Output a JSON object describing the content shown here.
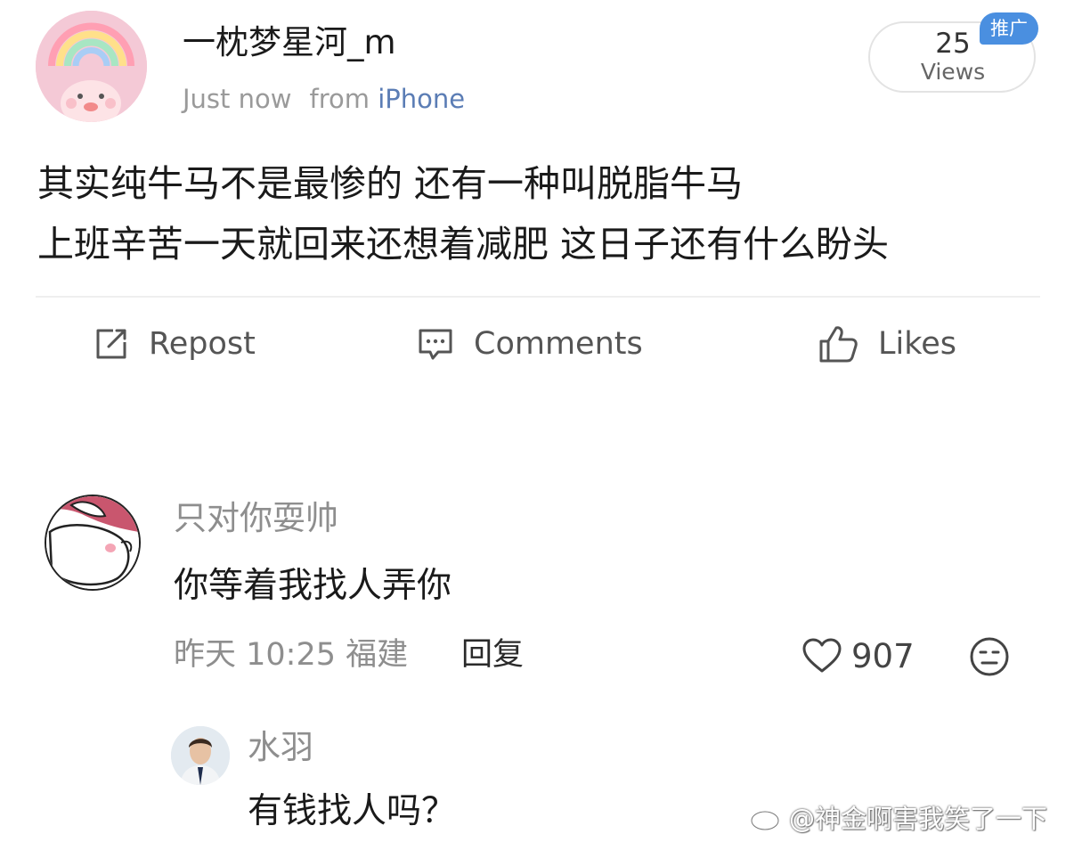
{
  "post": {
    "author": {
      "name": "一枕梦星河_m"
    },
    "timestamp": "Just now",
    "source_prefix": "from",
    "source_device": "iPhone",
    "views": {
      "count": "25",
      "label": "Views"
    },
    "promo_badge": "推广",
    "text_lines": [
      "其实纯牛马不是最惨的 还有一种叫脱脂牛马",
      "上班辛苦一天就回来还想着减肥 这日子还有什么盼头"
    ]
  },
  "actions": {
    "repost": "Repost",
    "comments": "Comments",
    "likes": "Likes"
  },
  "comments": [
    {
      "author": "只对你耍帅",
      "text": "你等着我找人弄你",
      "time": "昨天 10:25",
      "location": "福建",
      "reply_label": "回复",
      "likes": "907"
    },
    {
      "author": "水羽",
      "text": "有钱找人吗？"
    }
  ],
  "watermark": "@神金啊害我笑了一下",
  "colors": {
    "link_blue": "#5b7db5",
    "promo_blue": "#4a8fe0",
    "secondary_text": "#8e8e8e"
  }
}
